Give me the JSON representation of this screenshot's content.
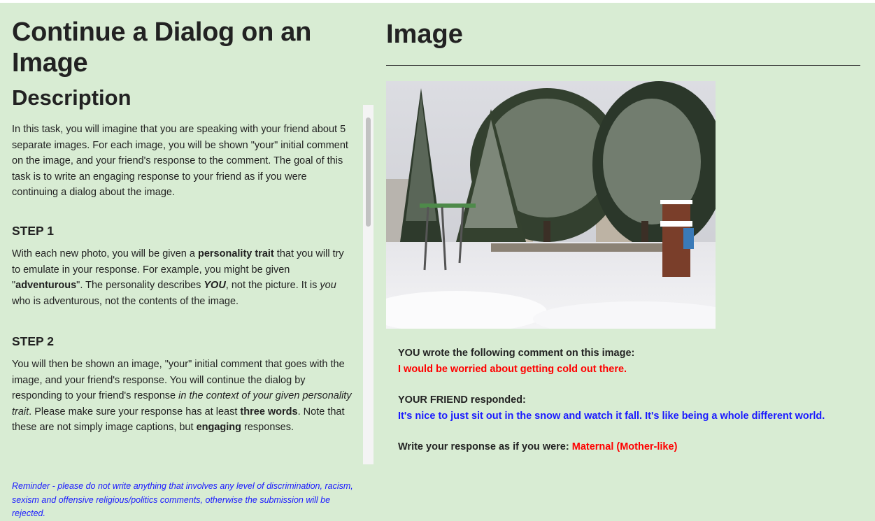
{
  "header": {
    "title": "Continue a Dialog on an Image"
  },
  "description": {
    "heading": "Description",
    "intro": "In this task, you will imagine that you are speaking with your friend about 5 separate images. For each image, you will be shown \"your\" initial comment on the image, and your friend's response to the comment. The goal of this task is to write an engaging response to your friend as if you were continuing a dialog about the image.",
    "step1": {
      "heading": "STEP 1",
      "t1": "With each new photo, you will be given a ",
      "b1": "personality trait",
      "t2": " that you will try to emulate in your response. For example, you might be given \"",
      "b2": "adventurous",
      "t3": "\". The personality describes ",
      "bi1": "YOU",
      "t4": ", not the picture. It is ",
      "i1": "you",
      "t5": " who is adventurous, not the contents of the image."
    },
    "step2": {
      "heading": "STEP 2",
      "t1": "You will then be shown an image, \"your\" initial comment that goes with the image, and your friend's response. You will continue the dialog by responding to your friend's response ",
      "i1": "in the context of your given personality trait",
      "t2": ". Please make sure your response has at least ",
      "b1": "three words",
      "t3": ". Note that these are not simply image captions, but ",
      "b2": "engaging",
      "t4": " responses."
    },
    "reminder": "Reminder - please do not write anything that involves any level of discrimination, racism, sexism and offensive religious/politics comments, otherwise the submission will be rejected."
  },
  "image_panel": {
    "heading": "Image",
    "you_label": "YOU wrote the following comment on this image:",
    "you_comment": "I would be worried about getting cold out there.",
    "friend_label": "YOUR FRIEND responded:",
    "friend_comment": "It's nice to just sit out in the snow and watch it fall. It's like being a whole different world.",
    "prompt_label": "Write your response as if you were: ",
    "personality": "Maternal (Mother-like)"
  },
  "colors": {
    "background": "#d8ecd3",
    "comment_red": "#ff0000",
    "friend_blue": "#1a1aff"
  }
}
